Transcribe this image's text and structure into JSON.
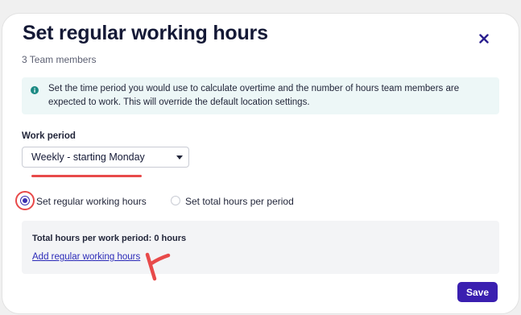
{
  "modal": {
    "title": "Set regular working hours",
    "subtitle": "3 Team members",
    "close_icon": "close-icon"
  },
  "info": {
    "icon": "info-icon",
    "text": "Set the time period you would use to calculate overtime and the number of hours team members are expected to work. This will override the default location settings."
  },
  "work_period": {
    "label": "Work period",
    "selected": "Weekly - starting Monday"
  },
  "mode": {
    "options": [
      {
        "label": "Set regular working hours",
        "checked": true
      },
      {
        "label": "Set total hours per period",
        "checked": false
      }
    ]
  },
  "summary": {
    "total_label": "Total hours per work period: 0 hours",
    "add_link": "Add regular working hours"
  },
  "actions": {
    "save_label": "Save"
  },
  "colors": {
    "primary": "#3a1fb0",
    "annotation": "#e84a4a",
    "info_bg": "#edf7f7",
    "info_icon": "#1c8a84"
  }
}
